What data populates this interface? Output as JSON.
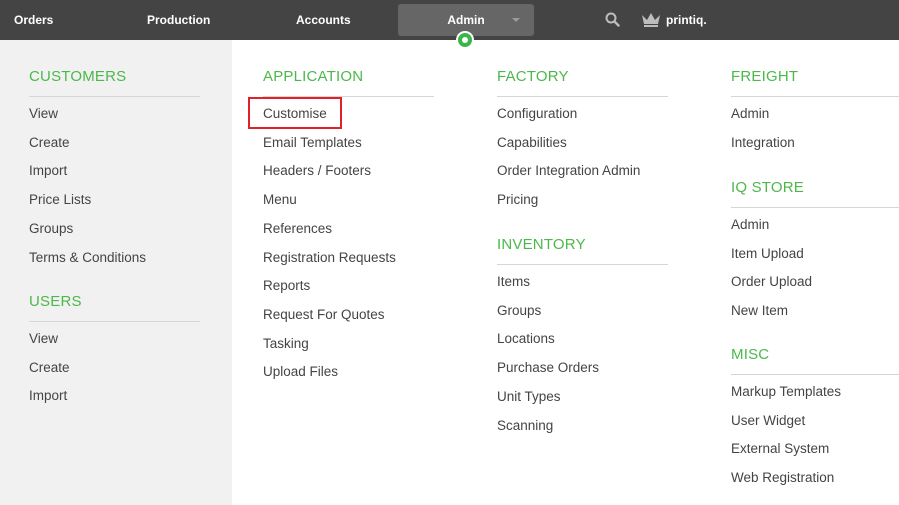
{
  "topbar": {
    "orders": "Orders",
    "production": "Production",
    "accounts": "Accounts",
    "admin": "Admin",
    "brand": "printiq.",
    "icons": {
      "search": "search-icon",
      "brand": "crown-icon",
      "dropdown": "chevron-down-icon"
    }
  },
  "colors": {
    "accent": "#4cb84a",
    "topbar": "#444444",
    "highlight": "#e0202a"
  },
  "sections": {
    "customers": {
      "title": "CUSTOMERS",
      "items": [
        "View",
        "Create",
        "Import",
        "Price Lists",
        "Groups",
        "Terms & Conditions"
      ]
    },
    "users": {
      "title": "USERS",
      "items": [
        "View",
        "Create",
        "Import"
      ]
    },
    "application": {
      "title": "APPLICATION",
      "items": [
        "Customise",
        "Email Templates",
        "Headers / Footers",
        "Menu",
        "References",
        "Registration Requests",
        "Reports",
        "Request For Quotes",
        "Tasking",
        "Upload Files"
      ]
    },
    "factory": {
      "title": "FACTORY",
      "items": [
        "Configuration",
        "Capabilities",
        "Order Integration Admin",
        "Pricing"
      ]
    },
    "inventory": {
      "title": "INVENTORY",
      "items": [
        "Items",
        "Groups",
        "Locations",
        "Purchase Orders",
        "Unit Types",
        "Scanning"
      ]
    },
    "freight": {
      "title": "FREIGHT",
      "items": [
        "Admin",
        "Integration"
      ]
    },
    "iq_store": {
      "title": "IQ STORE",
      "items": [
        "Admin",
        "Item Upload",
        "Order Upload",
        "New Item"
      ]
    },
    "misc": {
      "title": "MISC",
      "items": [
        "Markup Templates",
        "User Widget",
        "External System",
        "Web Registration"
      ]
    }
  }
}
